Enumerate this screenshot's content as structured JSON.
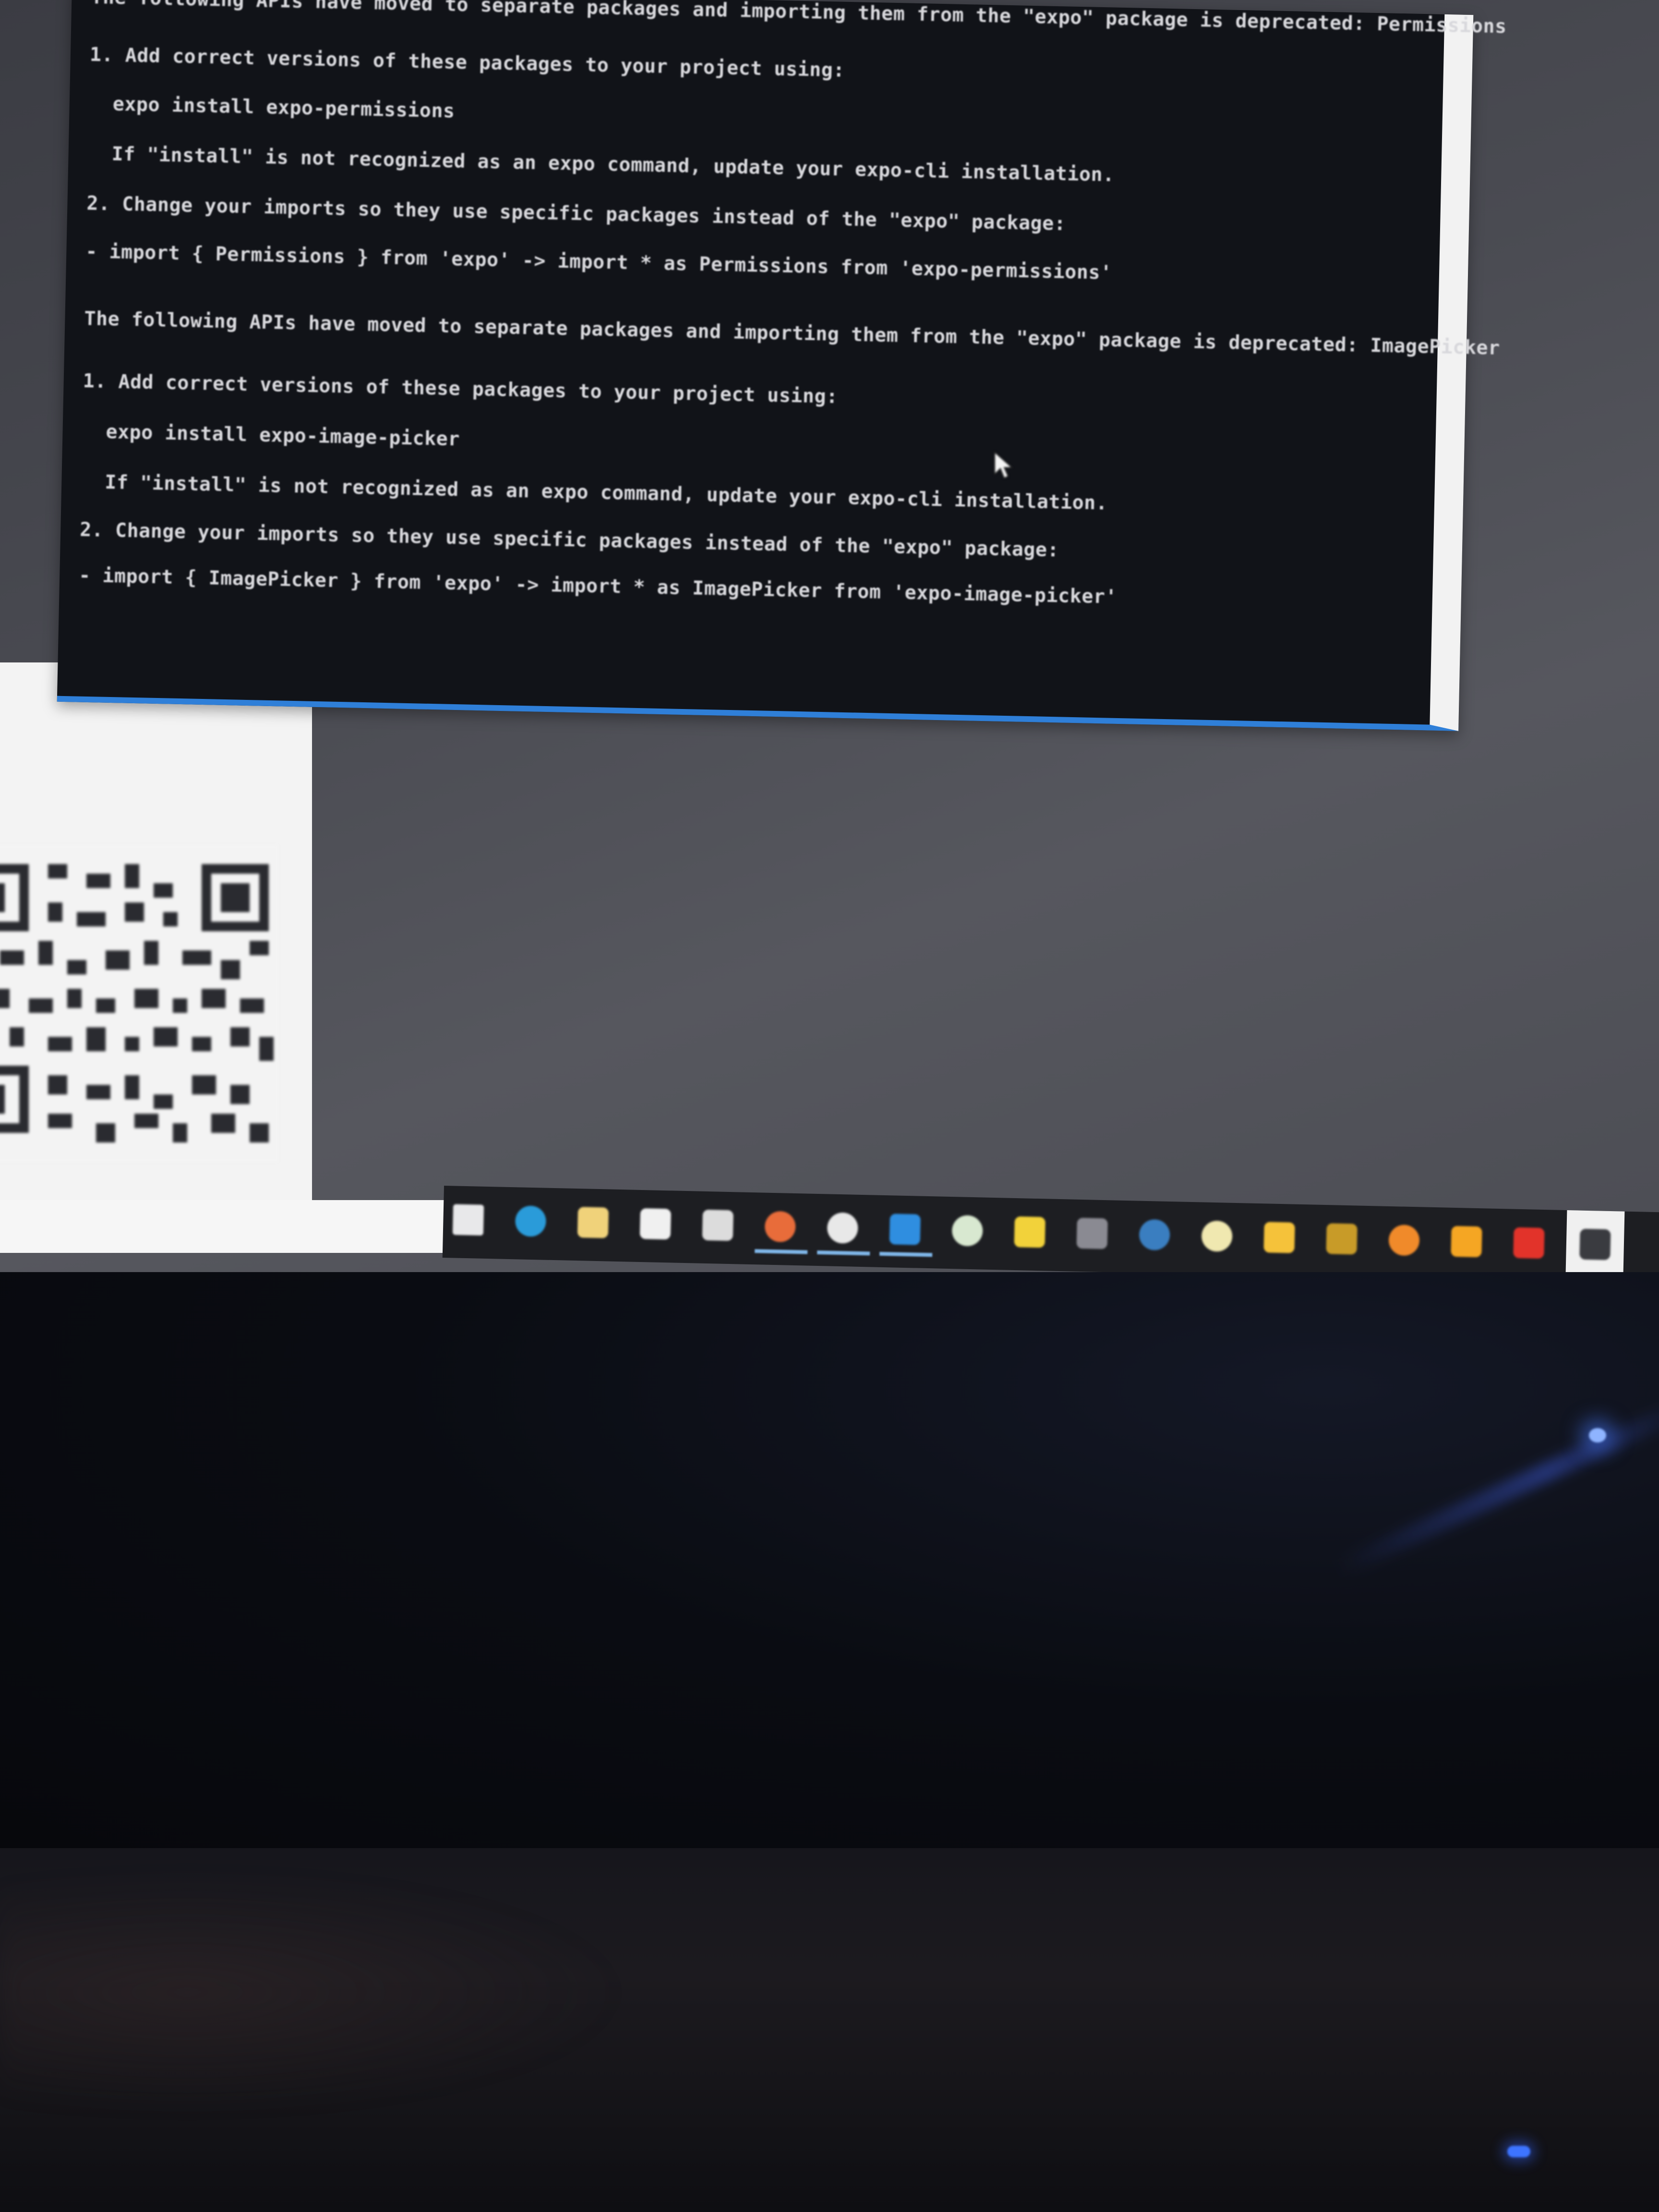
{
  "terminal": {
    "lines": [
      "The following APIs have moved to separate packages and importing them from the \"expo\" package is deprecated: Permissions",
      "1. Add correct versions of these packages to your project using:",
      "expo install expo-permissions",
      "If \"install\" is not recognized as an expo command, update your expo-cli installation.",
      "2. Change your imports so they use specific packages instead of the \"expo\" package:",
      "- import { Permissions } from 'expo' -> import * as Permissions from 'expo-permissions'",
      "The following APIs have moved to separate packages and importing them from the \"expo\" package is deprecated: ImagePicker",
      "1. Add correct versions of these packages to your project using:",
      "expo install expo-image-picker",
      "If \"install\" is not recognized as an expo command, update your expo-cli installation.",
      "2. Change your imports so they use specific packages instead of the \"expo\" package:",
      "- import { ImagePicker } from 'expo' -> import * as ImagePicker from 'expo-image-picker'"
    ]
  },
  "taskbar": {
    "icons": [
      "task-view-icon",
      "edge-icon",
      "file-explorer-icon",
      "store-icon",
      "mail-icon",
      "chrome-icon",
      "chrome-alt-icon",
      "vscode-icon",
      "app-circle-icon",
      "sticky-notes-icon",
      "network-icon",
      "steam-icon",
      "discord-icon",
      "folder-icon",
      "sync-icon",
      "color-picker-icon",
      "vlc-icon",
      "adobe-icon",
      "terminal-icon"
    ]
  },
  "colors": {
    "terminal_bg": "#111318",
    "terminal_text": "#d8d8dc",
    "accent_blue": "#2f7fd8",
    "taskbar_bg": "#1d1e22"
  }
}
